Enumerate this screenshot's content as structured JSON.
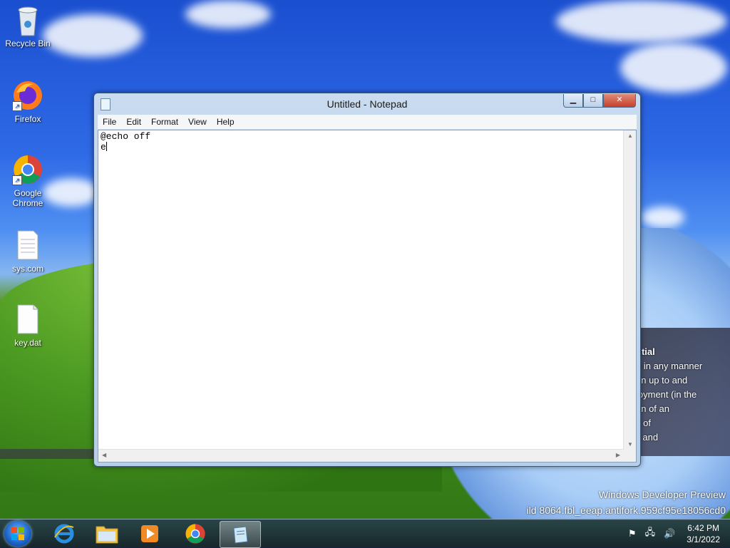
{
  "desktop": {
    "icons": [
      {
        "label": "Recycle Bin",
        "icon": "recycle-bin-icon"
      },
      {
        "label": "Firefox",
        "icon": "firefox-icon"
      },
      {
        "label": "Google Chrome",
        "icon": "chrome-icon"
      },
      {
        "label": "sys.com",
        "icon": "file-icon"
      },
      {
        "label": "key.dat",
        "icon": "file-icon"
      }
    ],
    "overlay_lines": [
      "ntial",
      "e in any manner",
      "on up to and",
      "loyment (in the",
      "on of an",
      "c    of",
      "    il and"
    ],
    "watermark_line1": "Windows Developer Preview",
    "watermark_line2": "ild 8064.fbl_eeap.antifork.959cf95e18056cd0"
  },
  "window": {
    "title": "Untitled - Notepad",
    "menu": [
      "File",
      "Edit",
      "Format",
      "View",
      "Help"
    ],
    "content_line1": "@echo off",
    "content_line2": "e",
    "buttons": {
      "minimize": "▁",
      "maximize": "□",
      "close": "✕"
    }
  },
  "taskbar": {
    "items": [
      "internet-explorer-icon",
      "file-explorer-icon",
      "media-player-icon",
      "chrome-icon",
      "notepad-icon"
    ],
    "time": "6:42 PM",
    "date": "3/1/2022"
  },
  "colors": {
    "accent": "#1a62c7",
    "close": "#c7402a"
  }
}
